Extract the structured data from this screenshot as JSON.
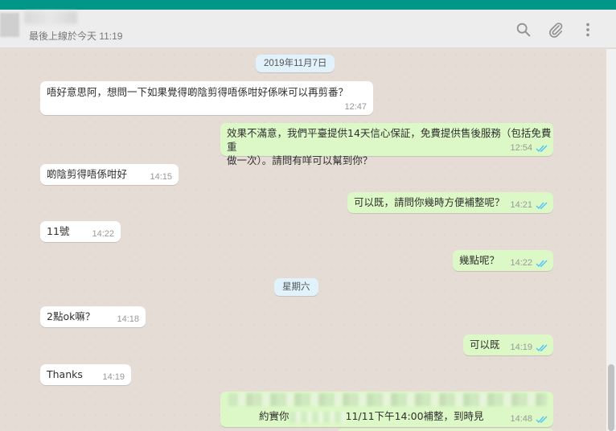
{
  "header": {
    "last_seen": "最後上線於今天 11:19",
    "icons": [
      "search-icon",
      "attach-icon",
      "menu-icon"
    ]
  },
  "date_separators": {
    "first": "2019年11月7日",
    "second": "星期六"
  },
  "messages": [
    {
      "dir": "in",
      "text": "唔好意思阿，想問一下如果覺得啲陰剪得唔係咁好係咪可以再剪番？",
      "time": "12:47"
    },
    {
      "dir": "out",
      "text_line1": "效果不滿意，我們平臺提供14天信心保証，免費提供售後服務（包括免費重",
      "text_line2": "做一次）。請問有咩可以幫到你？",
      "time": "12:54",
      "read": true
    },
    {
      "dir": "in",
      "text": "啲陰剪得唔係咁好",
      "time": "14:15"
    },
    {
      "dir": "out",
      "text": "可以既，請問你幾時方便補整呢？",
      "time": "14:21",
      "read": true
    },
    {
      "dir": "in",
      "text": "11號",
      "time": "14:22"
    },
    {
      "dir": "out",
      "text": "幾點呢？",
      "time": "14:22",
      "read": true
    },
    {
      "dir": "in",
      "text": "2點ok嘛？",
      "time": "14:18"
    },
    {
      "dir": "out",
      "text": "可以既",
      "time": "14:19",
      "read": true
    },
    {
      "dir": "in",
      "text": "Thanks",
      "time": "14:19"
    },
    {
      "dir": "out",
      "text_prefix": "約實你",
      "text_suffix": "11/11下午14:00補整，到時見",
      "time": "14:48",
      "read": true
    }
  ],
  "colors": {
    "topbar": "#009688",
    "incoming_bubble": "#ffffff",
    "outgoing_bubble": "#dcf8c6",
    "read_ticks": "#4fc3f7"
  }
}
